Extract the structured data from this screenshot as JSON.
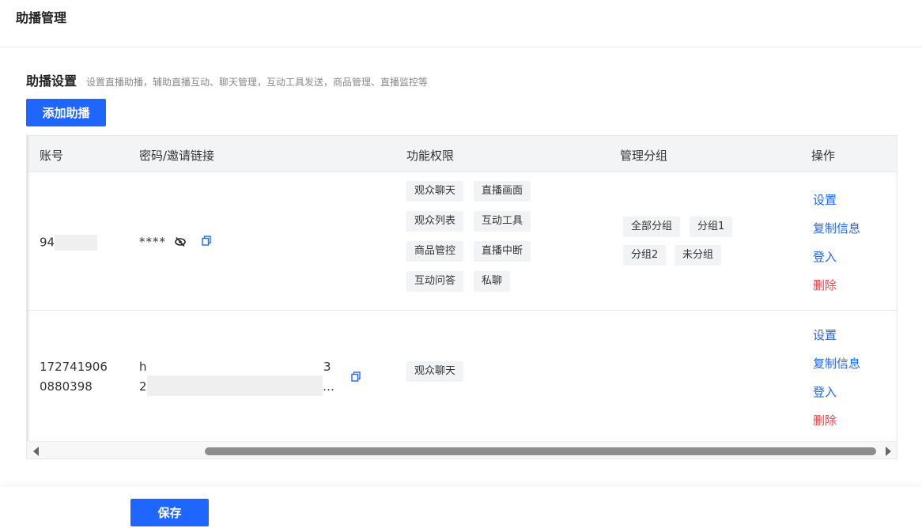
{
  "page": {
    "title": "助播管理"
  },
  "section": {
    "title": "助播设置",
    "description": "设置直播助播，辅助直播互动、聊天管理，互动工具发送，商品管理、直播监控等"
  },
  "toolbar": {
    "add_label": "添加助播"
  },
  "table": {
    "columns": {
      "account": "账号",
      "password": "密码/邀请链接",
      "permissions": "功能权限",
      "groups": "管理分组",
      "actions": "操作"
    },
    "rows": [
      {
        "account": "94",
        "password": "****",
        "permissions": [
          "观众聊天",
          "直播画面",
          "观众列表",
          "互动工具",
          "商品管控",
          "直播中断",
          "互动问答",
          "私聊"
        ],
        "groups": [
          "全部分组",
          "分组1",
          "分组2",
          "未分组"
        ],
        "actions": {
          "settings": "设置",
          "copy": "复制信息",
          "login": "登入",
          "delete": "删除"
        }
      },
      {
        "account_line1": "172741906",
        "account_line2": "0880398",
        "link_line1_start": "h",
        "link_line1_end": "3",
        "link_line2_start": "2",
        "link_line2_end": "…",
        "permissions": [
          "观众聊天"
        ],
        "groups": [],
        "actions": {
          "settings": "设置",
          "copy": "复制信息",
          "login": "登入",
          "delete": "删除"
        }
      }
    ]
  },
  "footer": {
    "save_label": "保存"
  },
  "colors": {
    "primary": "#1f66ff",
    "danger": "#e5484d",
    "tag_bg": "#f2f3f5",
    "header_bg": "#f3f4f6"
  },
  "icons": {
    "eye_off": "eye-off-icon",
    "copy": "copy-icon"
  }
}
